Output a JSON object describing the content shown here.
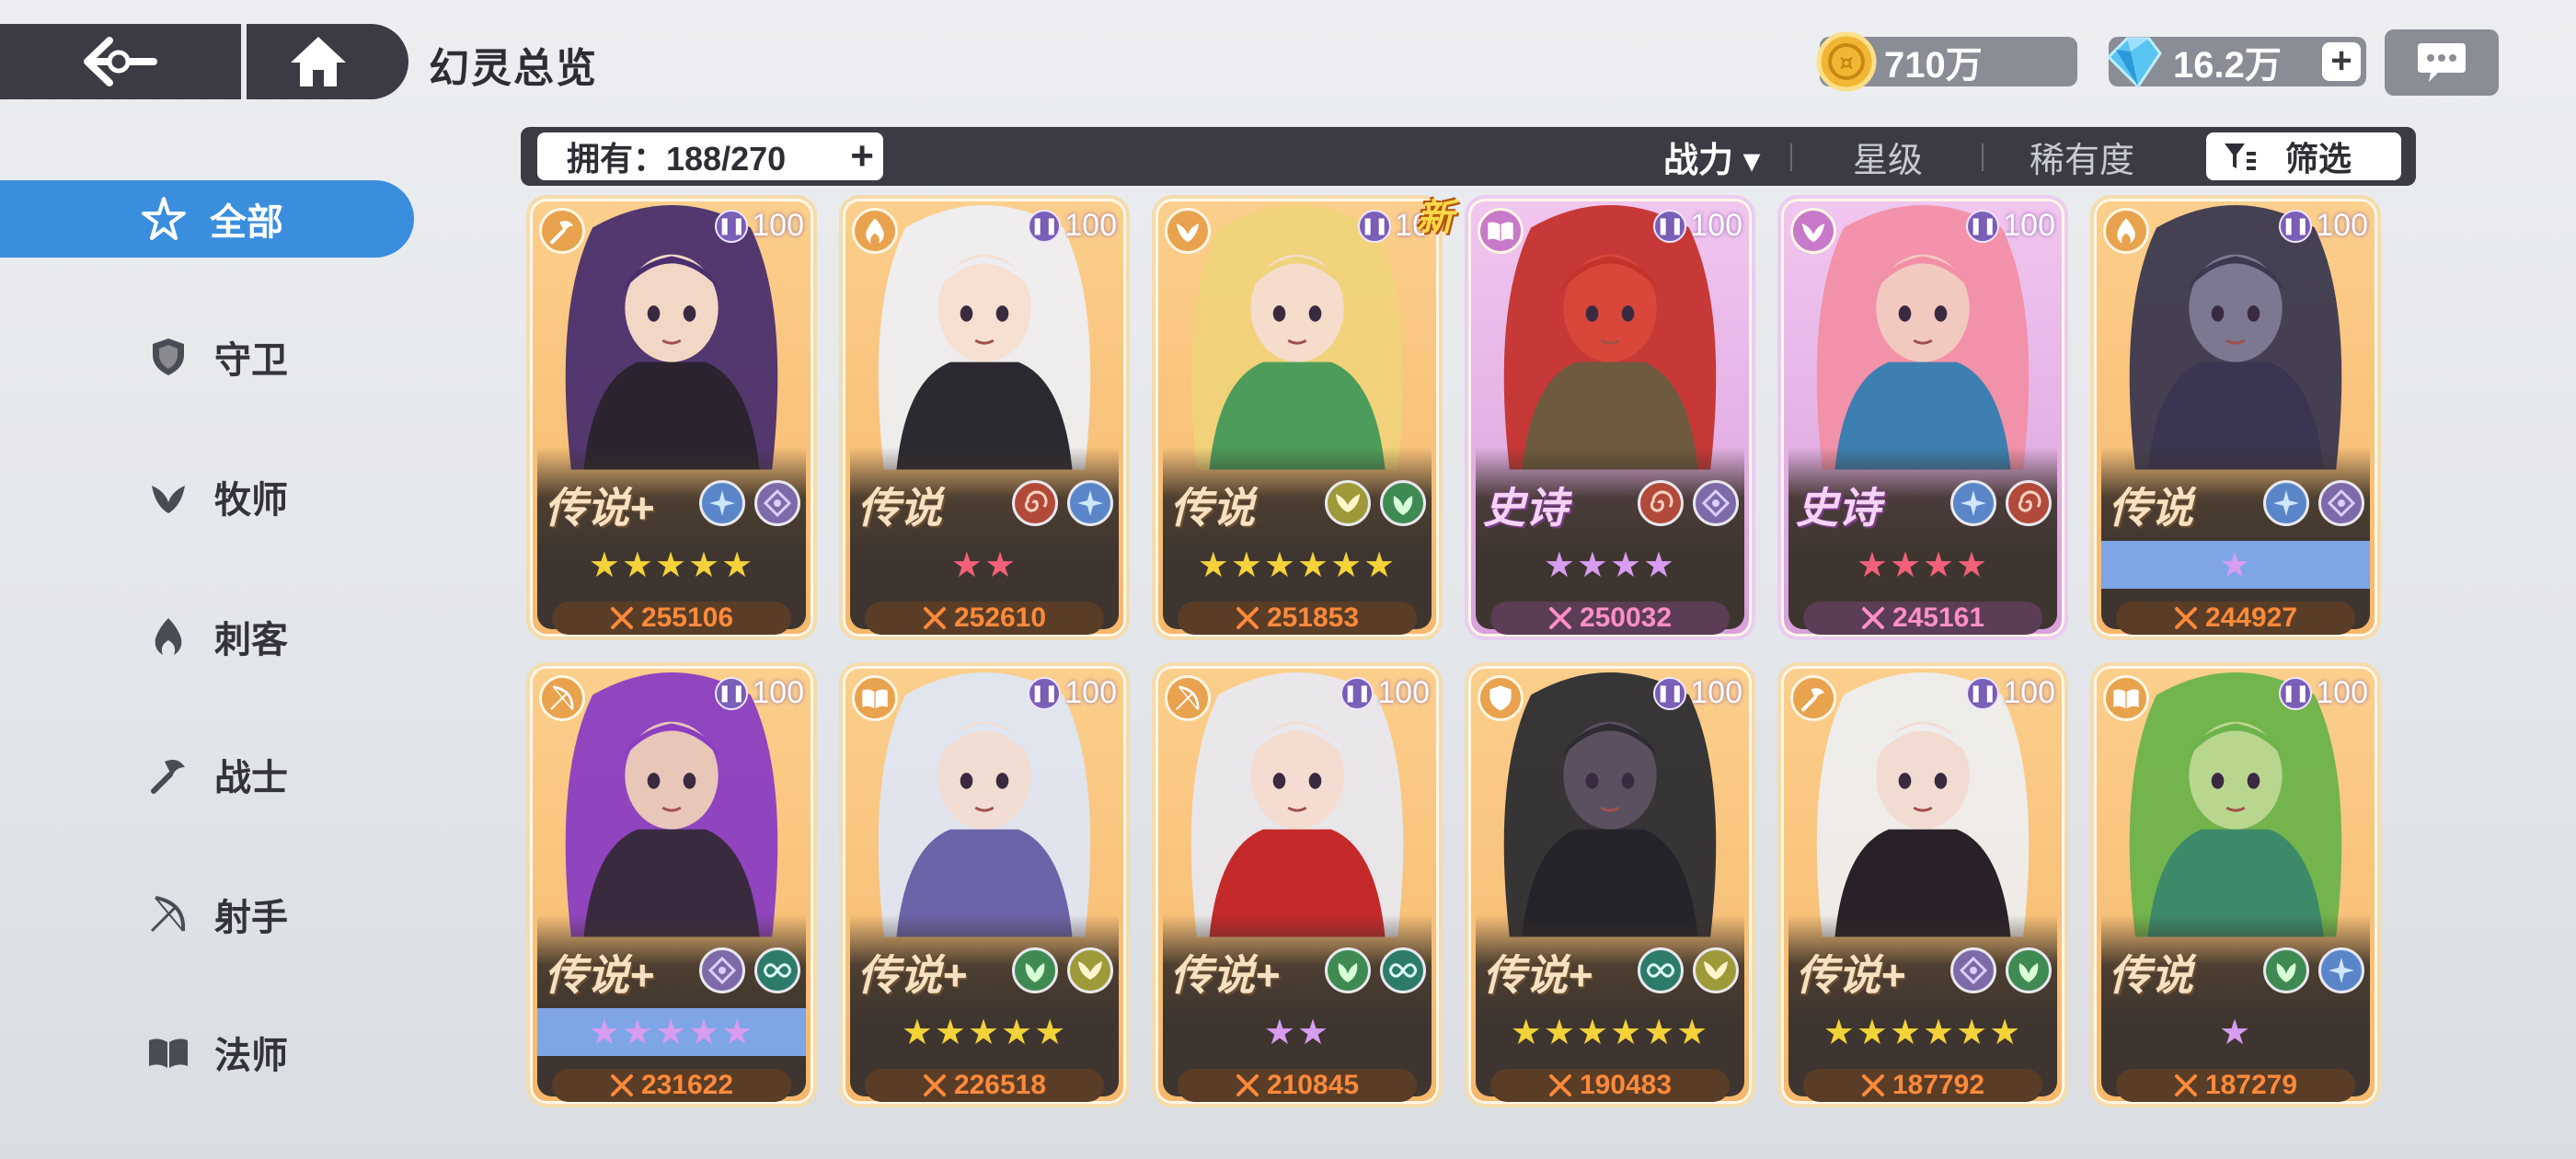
{
  "header": {
    "title": "幻灵总览",
    "gold": "710万",
    "gems": "16.2万"
  },
  "sidebar": {
    "items": [
      {
        "label": "全部",
        "icon": "star-swirl-icon",
        "active": true
      },
      {
        "label": "守卫",
        "icon": "shield-icon"
      },
      {
        "label": "牧师",
        "icon": "leaf-icon"
      },
      {
        "label": "刺客",
        "icon": "flame-claw-icon"
      },
      {
        "label": "战士",
        "icon": "axe-icon"
      },
      {
        "label": "射手",
        "icon": "bow-icon"
      },
      {
        "label": "法师",
        "icon": "book-icon"
      }
    ]
  },
  "filterbar": {
    "owned": "拥有：188/270",
    "sort_power": "战力 ▾",
    "sort_star": "星级",
    "sort_rarity": "稀有度",
    "filter": "筛选"
  },
  "new_tag": "新",
  "colors": {
    "accent": "#3b8ede",
    "bar": "#3a3b45",
    "legend_card": "#f6b86c",
    "epic_card": "#d9a0dc",
    "power_text": "#ff8a3a"
  },
  "cards": [
    {
      "class_icon": "axe-icon",
      "level": "100",
      "rarity": "传说+",
      "tier": "legend",
      "elements": [
        "frost-icon",
        "void-icon"
      ],
      "stars": "★★★★★",
      "star_color": "#f3d23a",
      "star_bg": "none",
      "power": "255106"
    },
    {
      "class_icon": "flame-claw-icon",
      "level": "100",
      "rarity": "传说",
      "tier": "legend",
      "elements": [
        "swirl-icon",
        "frost-icon"
      ],
      "stars": "★★",
      "star_color": "#f2607a",
      "star_bg": "none",
      "power": "252610"
    },
    {
      "class_icon": "leaf-icon",
      "level": "10",
      "rarity": "传说",
      "tier": "legend",
      "elements": [
        "wing-icon",
        "leaf-element-icon"
      ],
      "stars": "★★★★★★",
      "star_color": "#f3d23a",
      "star_bg": "none",
      "power": "251853"
    },
    {
      "class_icon": "book-icon",
      "level": "100",
      "rarity": "史诗",
      "tier": "epic",
      "elements": [
        "swirl-icon",
        "void-icon"
      ],
      "stars": "★★★★",
      "star_color": "#d89cf0",
      "star_bg": "none",
      "power": "250032"
    },
    {
      "class_icon": "leaf-icon",
      "level": "100",
      "rarity": "史诗",
      "tier": "epic",
      "elements": [
        "frost-icon",
        "swirl-icon"
      ],
      "stars": "★★★★",
      "star_color": "#f2607a",
      "star_bg": "none",
      "power": "245161"
    },
    {
      "class_icon": "flame-claw-icon",
      "level": "100",
      "rarity": "传说",
      "tier": "legend",
      "elements": [
        "frost-icon",
        "void-icon"
      ],
      "stars": "★",
      "star_color": "#d89cf0",
      "star_bg": "blue",
      "power": "244927"
    },
    {
      "class_icon": "bow-icon",
      "level": "100",
      "rarity": "传说+",
      "tier": "legend",
      "elements": [
        "void-icon",
        "infinity-icon"
      ],
      "stars": "★★★★★",
      "star_color": "#d89cf0",
      "star_bg": "blue",
      "power": "231622"
    },
    {
      "class_icon": "book-icon",
      "level": "100",
      "rarity": "传说+",
      "tier": "legend",
      "elements": [
        "leaf-element-icon",
        "wing-icon"
      ],
      "stars": "★★★★★",
      "star_color": "#f3d23a",
      "star_bg": "none",
      "power": "226518"
    },
    {
      "class_icon": "bow-icon",
      "level": "100",
      "rarity": "传说+",
      "tier": "legend",
      "elements": [
        "leaf-element-icon",
        "infinity-icon"
      ],
      "stars": "★★",
      "star_color": "#d89cf0",
      "star_bg": "none",
      "power": "210845"
    },
    {
      "class_icon": "shield-icon",
      "level": "100",
      "rarity": "传说+",
      "tier": "legend",
      "elements": [
        "infinity-icon",
        "wing-icon"
      ],
      "stars": "★★★★★★",
      "star_color": "#f3d23a",
      "star_bg": "none",
      "power": "190483"
    },
    {
      "class_icon": "axe-icon",
      "level": "100",
      "rarity": "传说+",
      "tier": "legend",
      "elements": [
        "void-icon",
        "leaf-element-icon"
      ],
      "stars": "★★★★★★",
      "star_color": "#f3d23a",
      "star_bg": "none",
      "power": "187792"
    },
    {
      "class_icon": "book-icon",
      "level": "100",
      "rarity": "传说",
      "tier": "legend",
      "elements": [
        "leaf-element-icon",
        "frost-icon"
      ],
      "stars": "★",
      "star_color": "#d89cf0",
      "star_bg": "none",
      "power": "187279"
    }
  ]
}
